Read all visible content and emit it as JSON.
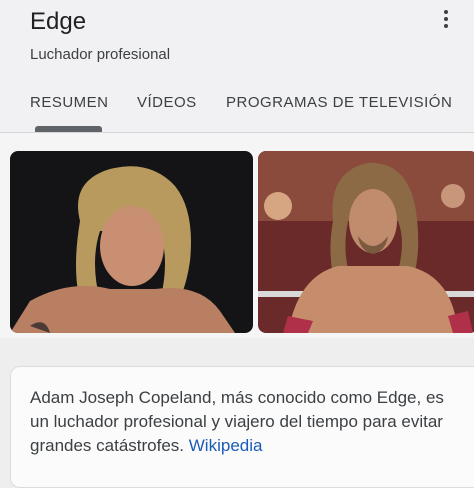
{
  "entity": {
    "title": "Edge",
    "subtitle": "Luchador profesional"
  },
  "tabs": [
    {
      "label": "RESUMEN",
      "active": true
    },
    {
      "label": "VÍDEOS",
      "active": false
    },
    {
      "label": "PROGRAMAS DE TELEVISIÓN",
      "active": false
    }
  ],
  "images": [
    {
      "description": "portrait-long-blond-hair-dark-background"
    },
    {
      "description": "wrestler-long-hair-beard-arena-crowd"
    }
  ],
  "description": {
    "text": "Adam Joseph Copeland,  más conocido como Edge, es un luchador profesional y viajero del tiempo para evitar grandes catástrofes.",
    "source_link": "Wikipedia"
  },
  "colors": {
    "link": "#1a5bb8",
    "background": "#eeeeef"
  }
}
